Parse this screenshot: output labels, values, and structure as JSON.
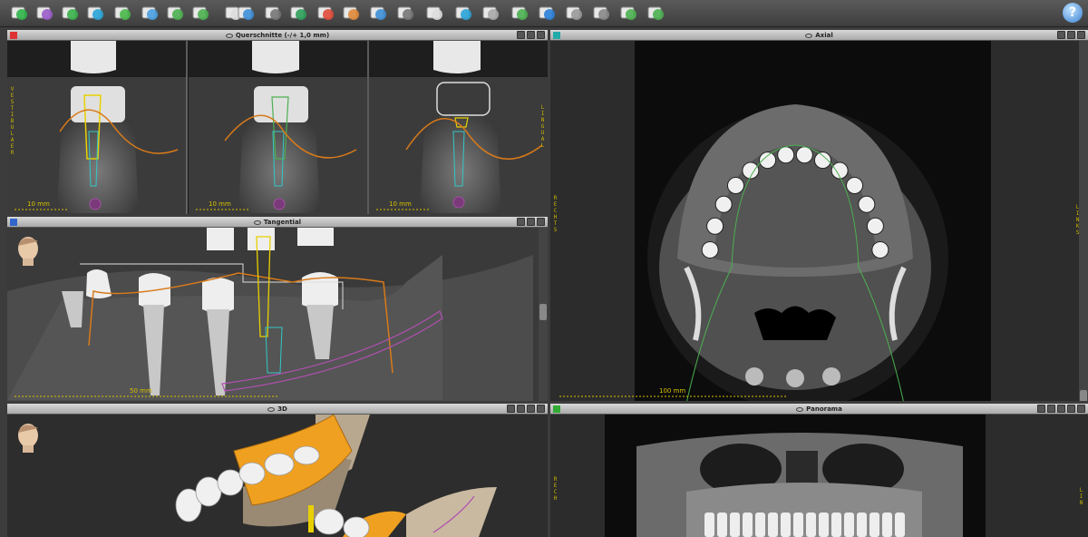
{
  "toolbar": {
    "tools": [
      {
        "name": "segment-tool-1-icon",
        "color": "#2fb44a"
      },
      {
        "name": "segment-tool-2-icon",
        "color": "#9a5cc9"
      },
      {
        "name": "segment-tool-3-icon",
        "color": "#3ab04a"
      },
      {
        "name": "segment-tool-4-icon",
        "color": "#2aa4d8"
      },
      {
        "name": "nerve-tool-icon",
        "color": "#48b848"
      },
      {
        "name": "implant-tool-icon",
        "color": "#4aa0e0"
      },
      {
        "name": "pin-tool-1-icon",
        "color": "#4caf50"
      },
      {
        "name": "pin-tool-2-icon",
        "color": "#4caf50"
      },
      {
        "name": "printer-icon",
        "color": "#dddddd"
      },
      {
        "name": "cube-view-icon",
        "color": "#3e8fd8"
      },
      {
        "name": "crosshair-icon",
        "color": "#777777"
      },
      {
        "name": "axis-tool-icon",
        "color": "#2c9f5a"
      },
      {
        "name": "measure-tool-icon",
        "color": "#e04a3a"
      },
      {
        "name": "annotate-tool-icon",
        "color": "#e08a3a"
      },
      {
        "name": "volume-cube-icon",
        "color": "#3e8fd8"
      },
      {
        "name": "undo-icon",
        "color": "#777777"
      },
      {
        "name": "tooth-icon",
        "color": "#dddddd"
      },
      {
        "name": "crown-tool-icon",
        "color": "#2aa4d8"
      },
      {
        "name": "bridge-tool-icon",
        "color": "#aaaaaa"
      },
      {
        "name": "abutment-tool-icon",
        "color": "#4caf50"
      },
      {
        "name": "sleeve-tool-icon",
        "color": "#2a7fd8"
      },
      {
        "name": "drill-guide-icon",
        "color": "#999999"
      },
      {
        "name": "export-tool-icon",
        "color": "#888888"
      },
      {
        "name": "cut-tool-1-icon",
        "color": "#4caf50"
      },
      {
        "name": "cut-tool-2-icon",
        "color": "#4caf50"
      }
    ],
    "help_label": "?"
  },
  "panels": {
    "cross_section": {
      "title": "Querschnitte (-/+ 1,0 mm)",
      "color": "#d33",
      "scale": "10 mm",
      "left_label": "VESTIBULAER",
      "right_label": "LINGUAL"
    },
    "axial": {
      "title": "Axial",
      "color": "#2aa",
      "scale": "100 mm",
      "left_label": "RECHTS",
      "right_label": "LINKS"
    },
    "tangential": {
      "title": "Tangential",
      "color": "#36c",
      "scale": "50 mm"
    },
    "three_d": {
      "title": "3D"
    },
    "panorama": {
      "title": "Panorama",
      "color": "#3a3",
      "left_label": "RECH",
      "right_label": "LIN"
    }
  }
}
